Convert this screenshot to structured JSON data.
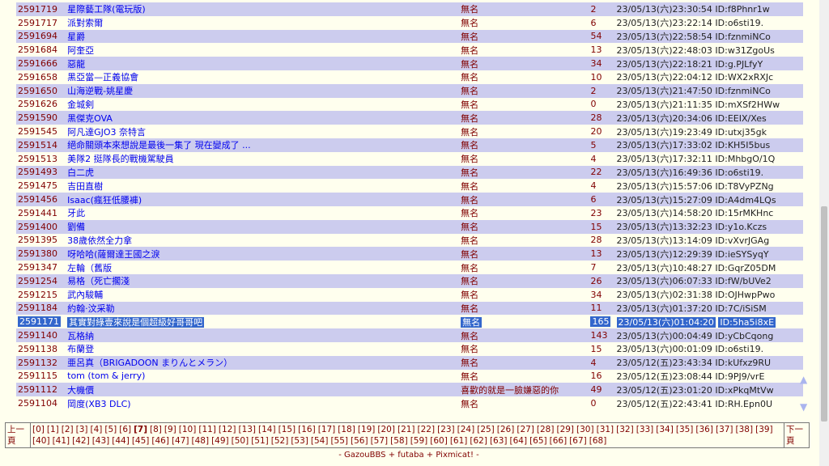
{
  "threads": [
    {
      "no": "2591719",
      "title": "星際藝工隊(電玩版)",
      "name": "無名",
      "count": "2",
      "date": "23/05/13(六)23:30:54",
      "id": "ID:f8Phnr1w"
    },
    {
      "no": "2591717",
      "title": "派對索爾",
      "name": "無名",
      "count": "6",
      "date": "23/05/13(六)23:22:14",
      "id": "ID:o6sti19."
    },
    {
      "no": "2591694",
      "title": "星爵",
      "name": "無名",
      "count": "54",
      "date": "23/05/13(六)22:58:54",
      "id": "ID:fznmiNCo"
    },
    {
      "no": "2591684",
      "title": "阿奎亞",
      "name": "無名",
      "count": "13",
      "date": "23/05/13(六)22:48:03",
      "id": "ID:w31ZgoUs"
    },
    {
      "no": "2591666",
      "title": "惡龍",
      "name": "無名",
      "count": "34",
      "date": "23/05/13(六)22:18:21",
      "id": "ID:g.PJLfyY"
    },
    {
      "no": "2591658",
      "title": "黑亞當—正義協會",
      "name": "無名",
      "count": "10",
      "date": "23/05/13(六)22:04:12",
      "id": "ID:WX2xRXJc"
    },
    {
      "no": "2591650",
      "title": "山海逆戰-姚星慶",
      "name": "無名",
      "count": "2",
      "date": "23/05/13(六)21:47:50",
      "id": "ID:fznmiNCo"
    },
    {
      "no": "2591626",
      "title": "金城剣",
      "name": "無名",
      "count": "0",
      "date": "23/05/13(六)21:11:35",
      "id": "ID:mXSf2HWw"
    },
    {
      "no": "2591590",
      "title": "黑傑克OVA",
      "name": "無名",
      "count": "28",
      "date": "23/05/13(六)20:34:06",
      "id": "ID:EEIX/Xes"
    },
    {
      "no": "2591545",
      "title": "阿凡達GJO3 奈特言",
      "name": "無名",
      "count": "20",
      "date": "23/05/13(六)19:23:49",
      "id": "ID:utxj35gk"
    },
    {
      "no": "2591514",
      "title": "絕命關頭本來想說是最後一集了 現在變成了 ...",
      "name": "無名",
      "count": "5",
      "date": "23/05/13(六)17:33:02",
      "id": "ID:KH5I5bus"
    },
    {
      "no": "2591513",
      "title": "美隊2 挺隊長的戰機駕駛員",
      "name": "無名",
      "count": "4",
      "date": "23/05/13(六)17:32:11",
      "id": "ID:MhbgO/1Q"
    },
    {
      "no": "2591493",
      "title": "白二虎",
      "name": "無名",
      "count": "22",
      "date": "23/05/13(六)16:49:36",
      "id": "ID:o6sti19."
    },
    {
      "no": "2591475",
      "title": "吉田直樹",
      "name": "無名",
      "count": "4",
      "date": "23/05/13(六)15:57:06",
      "id": "ID:T8VyPZNg"
    },
    {
      "no": "2591456",
      "title": "Isaac(瘋狂低腰褲)",
      "name": "無名",
      "count": "6",
      "date": "23/05/13(六)15:27:09",
      "id": "ID:A4dm4LQs"
    },
    {
      "no": "2591441",
      "title": "牙此",
      "name": "無名",
      "count": "23",
      "date": "23/05/13(六)14:58:20",
      "id": "ID:15rMKHnc"
    },
    {
      "no": "2591400",
      "title": "劉備",
      "name": "無名",
      "count": "15",
      "date": "23/05/13(六)13:32:23",
      "id": "ID:y1o.Kczs"
    },
    {
      "no": "2591395",
      "title": "38歲依然全力拿",
      "name": "無名",
      "count": "28",
      "date": "23/05/13(六)13:14:09",
      "id": "ID:vXvrJGAg"
    },
    {
      "no": "2591380",
      "title": "呀哈哈(薩爾達王國之淚",
      "name": "無名",
      "count": "13",
      "date": "23/05/13(六)12:29:39",
      "id": "ID:ieSYSyqY"
    },
    {
      "no": "2591347",
      "title": "左輪（舊版",
      "name": "無名",
      "count": "7",
      "date": "23/05/13(六)10:48:27",
      "id": "ID:GqrZ05DM"
    },
    {
      "no": "2591254",
      "title": "易格（死亡擱淺",
      "name": "無名",
      "count": "26",
      "date": "23/05/13(六)06:07:33",
      "id": "ID:fW/bUVe2"
    },
    {
      "no": "2591215",
      "title": "武內駿輔",
      "name": "無名",
      "count": "34",
      "date": "23/05/13(六)02:31:38",
      "id": "ID:OJHwpPwo"
    },
    {
      "no": "2591184",
      "title": "約翰·汶采勒",
      "name": "無名",
      "count": "11",
      "date": "23/05/13(六)01:37:20",
      "id": "ID:7C/iSiSM"
    },
    {
      "no": "2591171",
      "title": "其實對綠壹來說是個超級好哥哥吧",
      "name": "無名",
      "count": "165",
      "date": "23/05/13(六)01:04:20",
      "id": "ID:5ha5i8xE"
    },
    {
      "no": "2591140",
      "title": "瓦格納",
      "name": "無名",
      "count": "143",
      "date": "23/05/13(六)00:04:49",
      "id": "ID:yCbCqong"
    },
    {
      "no": "2591138",
      "title": "布蘭登",
      "name": "無名",
      "count": "15",
      "date": "23/05/13(六)00:01:09",
      "id": "ID:o6sti19."
    },
    {
      "no": "2591132",
      "title": "亜呂真（BRIGADOON まりんとメラン）",
      "name": "無名",
      "count": "4",
      "date": "23/05/12(五)23:43:34",
      "id": "ID:kUfxz9RU"
    },
    {
      "no": "2591115",
      "title": "tom (tom & jerry)",
      "name": "無名",
      "count": "16",
      "date": "23/05/12(五)23:08:44",
      "id": "ID:9PJ9/vrE"
    },
    {
      "no": "2591112",
      "title": "大機價",
      "name": "喜歡的就是一臉嫌惡的你",
      "count": "49",
      "date": "23/05/12(五)23:01:20",
      "id": "ID:xPkqMtVw"
    },
    {
      "no": "2591104",
      "title": "岡度(XB3 DLC)",
      "name": "無名",
      "count": "0",
      "date": "23/05/12(五)22:43:41",
      "id": "ID:RH.Epn0U"
    }
  ],
  "selected_row": 23,
  "pager": {
    "prev_label": "上一頁",
    "next_label": "下一頁",
    "pages": [
      "[0]",
      "[1]",
      "[2]",
      "[3]",
      "[4]",
      "[5]",
      "[6]",
      "[7]",
      "[8]",
      "[9]",
      "[10]",
      "[11]",
      "[12]",
      "[13]",
      "[14]",
      "[15]",
      "[16]",
      "[17]",
      "[18]",
      "[19]",
      "[20]",
      "[21]",
      "[22]",
      "[23]",
      "[24]",
      "[25]",
      "[26]",
      "[27]",
      "[28]",
      "[29]",
      "[30]",
      "[31]",
      "[32]",
      "[33]",
      "[34]",
      "[35]",
      "[36]",
      "[37]",
      "[38]",
      "[39]",
      "[40]",
      "[41]",
      "[42]",
      "[43]",
      "[44]",
      "[45]",
      "[46]",
      "[47]",
      "[48]",
      "[49]",
      "[50]",
      "[51]",
      "[52]",
      "[53]",
      "[54]",
      "[55]",
      "[56]",
      "[57]",
      "[58]",
      "[59]",
      "[60]",
      "[61]",
      "[62]",
      "[63]",
      "[64]",
      "[65]",
      "[66]",
      "[67]",
      "[68]"
    ],
    "current_page": "[7]"
  },
  "footer": "- GazouBBS + futaba + Pixmicat! -",
  "icons": {
    "scroll_up": "▲",
    "scroll_down": "▼"
  },
  "colors": {
    "row_alt": "#ccccee",
    "row_base": "#ffffee",
    "link": "#0000ee",
    "selection": "#3366cc",
    "text": "#800000"
  }
}
